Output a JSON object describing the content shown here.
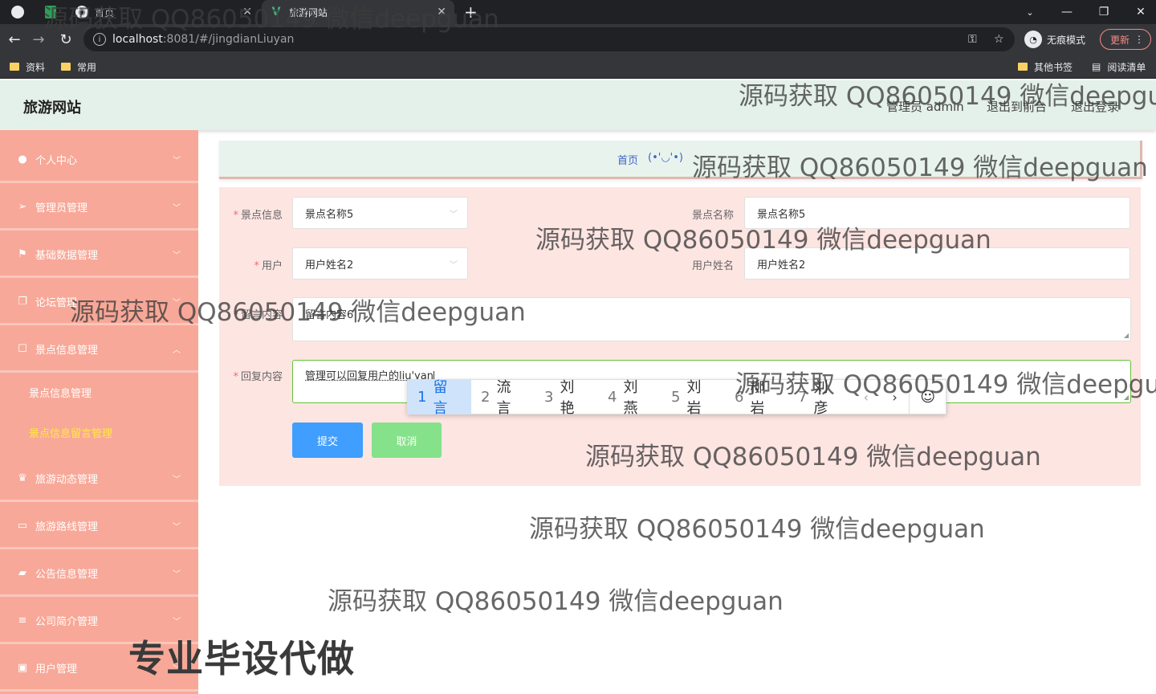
{
  "browser": {
    "tabs": [
      {
        "label": "首页",
        "active": false
      },
      {
        "label": "旅游网站",
        "active": true
      }
    ],
    "address": {
      "host": "localhost",
      "path": ":8081/#/jingdianLiuyan"
    },
    "incognito_label": "无痕模式",
    "update_label": "更新",
    "bookmarks": [
      "资料",
      "常用"
    ],
    "bookmarks_right": [
      "其他书签",
      "阅读清单"
    ]
  },
  "header": {
    "site_title": "旅游网站",
    "user": "管理员 admin",
    "to_front": "退出到前台",
    "logout": "退出登录"
  },
  "sidebar": {
    "items": [
      {
        "label": "个人中心",
        "icon": "user-icon"
      },
      {
        "label": "管理员管理",
        "icon": "send-icon"
      },
      {
        "label": "基础数据管理",
        "icon": "flag-icon"
      },
      {
        "label": "论坛管理",
        "icon": "copy-icon"
      },
      {
        "label": "景点信息管理",
        "icon": "square-icon",
        "expanded": true
      },
      {
        "label": "旅游动态管理",
        "icon": "trophy-icon"
      },
      {
        "label": "旅游路线管理",
        "icon": "monitor-icon"
      },
      {
        "label": "公告信息管理",
        "icon": "briefcase-icon"
      },
      {
        "label": "公司简介管理",
        "icon": "menu-icon"
      },
      {
        "label": "用户管理",
        "icon": "id-card-icon"
      }
    ],
    "sub_items": [
      {
        "label": "景点信息管理",
        "active": false
      },
      {
        "label": "景点信息留言管理",
        "active": true
      }
    ]
  },
  "breadcrumb": {
    "home": "首页",
    "face": "(•'◡'•)"
  },
  "form": {
    "scenic_info_label": "景点信息",
    "scenic_info_value": "景点名称5",
    "scenic_name_label": "景点名称",
    "scenic_name_value": "景点名称5",
    "user_label": "用户",
    "user_value": "用户姓名2",
    "user_name_label": "用户姓名",
    "user_name_value": "用户姓名2",
    "message_label": "留言内容",
    "message_value": "留言内容6",
    "reply_label": "回复内容",
    "reply_value": "管理可以回复用户的liu'yan",
    "submit": "提交",
    "cancel": "取消"
  },
  "ime": {
    "candidates": [
      {
        "n": "1",
        "text": "留言"
      },
      {
        "n": "2",
        "text": "流言"
      },
      {
        "n": "3",
        "text": "刘艳"
      },
      {
        "n": "4",
        "text": "刘燕"
      },
      {
        "n": "5",
        "text": "刘岩"
      },
      {
        "n": "6",
        "text": "柳岩"
      },
      {
        "n": "7",
        "text": "刘彦"
      }
    ]
  },
  "watermark": {
    "text": "源码获取 QQ86050149 微信deepguan",
    "tagline": "专业毕设代做"
  },
  "colors": {
    "sidebar": "#f8a898",
    "header": "#e4f0ea",
    "form_bg": "#fde5e2",
    "submit": "#409eff",
    "cancel": "#85e28a",
    "active_sub": "#ffeb3b"
  }
}
